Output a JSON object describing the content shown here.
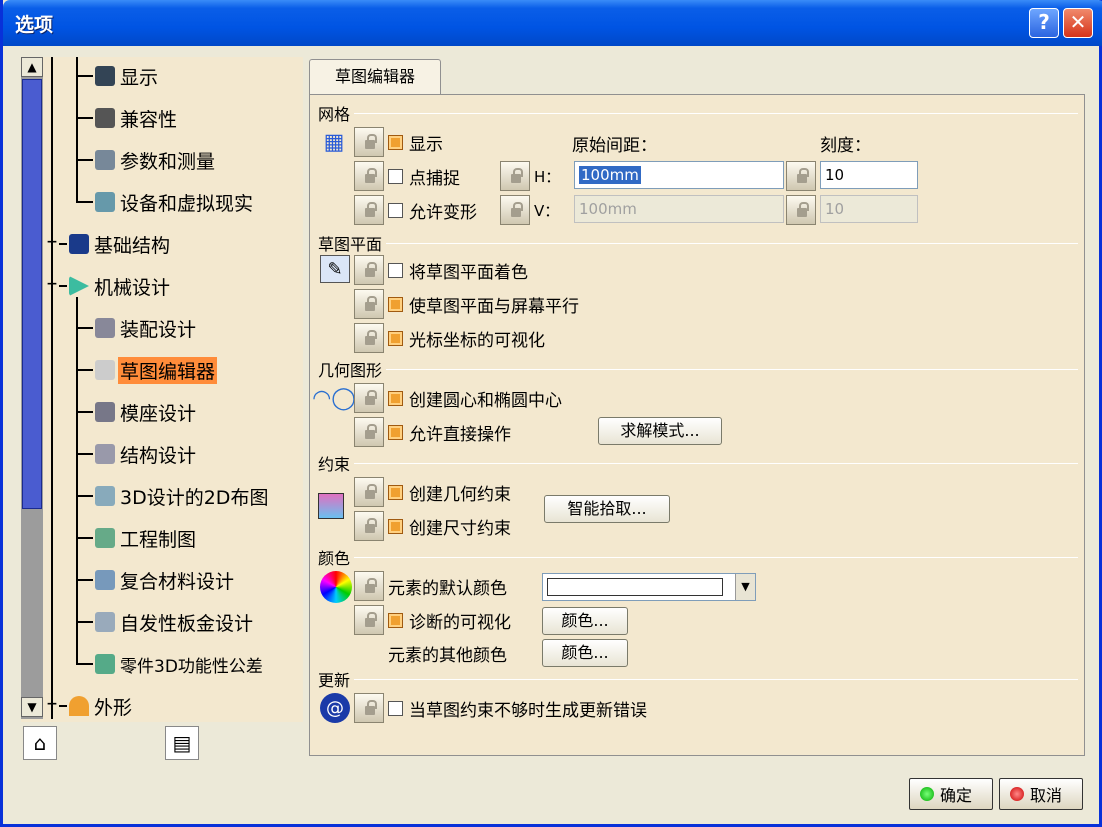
{
  "window": {
    "title": "选项",
    "help_glyph": "?",
    "close_glyph": "✕"
  },
  "tree": {
    "scroll_up": "▲",
    "scroll_down": "▼",
    "items": [
      {
        "label": "显示",
        "icon": "display-icon"
      },
      {
        "label": "兼容性",
        "icon": "compatibility-icon"
      },
      {
        "label": "参数和测量",
        "icon": "parameters-icon"
      },
      {
        "label": "设备和虚拟现实",
        "icon": "devices-icon"
      },
      {
        "label": "基础结构",
        "icon": "infrastructure-icon"
      },
      {
        "label": "机械设计",
        "icon": "mechanical-design-icon"
      },
      {
        "label": "装配设计",
        "icon": "assembly-icon"
      },
      {
        "label": "草图编辑器",
        "icon": "sketcher-icon",
        "selected": true
      },
      {
        "label": "模座设计",
        "icon": "mold-icon"
      },
      {
        "label": "结构设计",
        "icon": "structure-icon"
      },
      {
        "label": "3D设计的2D布图",
        "icon": "layout-icon"
      },
      {
        "label": "工程制图",
        "icon": "drafting-icon"
      },
      {
        "label": "复合材料设计",
        "icon": "composites-icon"
      },
      {
        "label": "自发性板金设计",
        "icon": "sheetmetal-icon"
      },
      {
        "label": "零件3D功能性公差",
        "icon": "tolerance-icon"
      },
      {
        "label": "外形",
        "icon": "shape-icon"
      }
    ]
  },
  "tab": {
    "label": "草图编辑器"
  },
  "grid": {
    "title": "网格",
    "display": "显示",
    "snap": "点捕捉",
    "distortion": "允许变形",
    "primary_spacing": "原始间距：",
    "graduations": "刻度：",
    "h_label": "H：",
    "v_label": "V：",
    "h_spacing": "100mm",
    "v_spacing": "100mm",
    "h_grad": "10",
    "v_grad": "10"
  },
  "sketch_plane": {
    "title": "草图平面",
    "shade": "将草图平面着色",
    "parallel": "使草图平面与屏幕平行",
    "cursor": "光标坐标的可视化"
  },
  "geometry": {
    "title": "几何图形",
    "centers": "创建圆心和椭圆中心",
    "direct": "允许直接操作",
    "solving_btn": "求解模式..."
  },
  "constraint": {
    "title": "约束",
    "geometric": "创建几何约束",
    "dimensional": "创建尺寸约束",
    "smartpick_btn": "智能拾取..."
  },
  "colors": {
    "title": "颜色",
    "default_color": "元素的默认颜色",
    "diagnosis": "诊断的可视化",
    "other": "元素的其他颜色",
    "color_btn": "颜色..."
  },
  "update": {
    "title": "更新",
    "error": "当草图约束不够时生成更新错误"
  },
  "buttons": {
    "ok": "确定",
    "cancel": "取消"
  }
}
